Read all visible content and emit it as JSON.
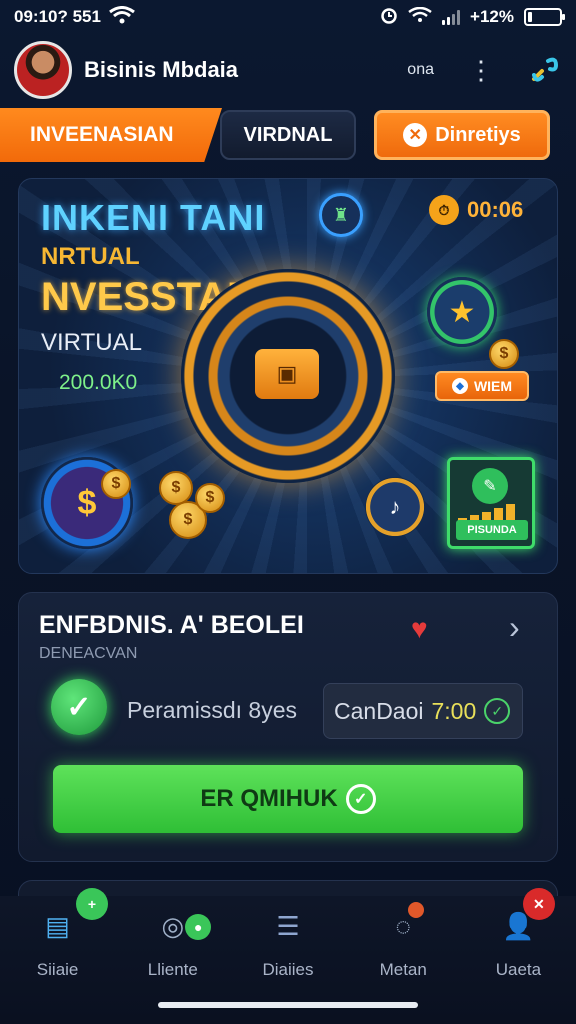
{
  "status_bar": {
    "time": "09:10? 551",
    "battery_text": "+12%",
    "battery_level": 0.12
  },
  "header": {
    "username": "Bisinis Mbdaia",
    "right_text": "ona"
  },
  "tabs": {
    "left": "INVEENASIAN",
    "middle": "VIRDNAL",
    "right": "Dinretiys"
  },
  "hero": {
    "title": "INKENI TANI",
    "subtitle": "NRTUAL",
    "headline": "NVESSTABII",
    "subtitle2": "VIRTUAL",
    "amount": "200.0K0",
    "timer": "00:06",
    "win_badge": "WIEM",
    "chart_label": "PISUNDA"
  },
  "card": {
    "title": "ENFBDNIS. A' BEOLEI",
    "subtitle": "DENEACVAN",
    "permission_label": "Peramissdı 8yes",
    "time_label": "CanDaoi",
    "time_value": "7:00",
    "cta_label": "ER QMIHUK"
  },
  "bottom_nav": [
    {
      "label": "Siiaie",
      "icon": "briefcase-icon"
    },
    {
      "label": "Lliente",
      "icon": "coins-icon"
    },
    {
      "label": "Diaiies",
      "icon": "list-icon"
    },
    {
      "label": "Metan",
      "icon": "chat-icon"
    },
    {
      "label": "Uaeta",
      "icon": "user-icon"
    }
  ],
  "colors": {
    "accent_orange": "#f26a0a",
    "accent_green": "#2fbf36",
    "title_blue": "#5fd2ff",
    "gold": "#ffc94a"
  }
}
